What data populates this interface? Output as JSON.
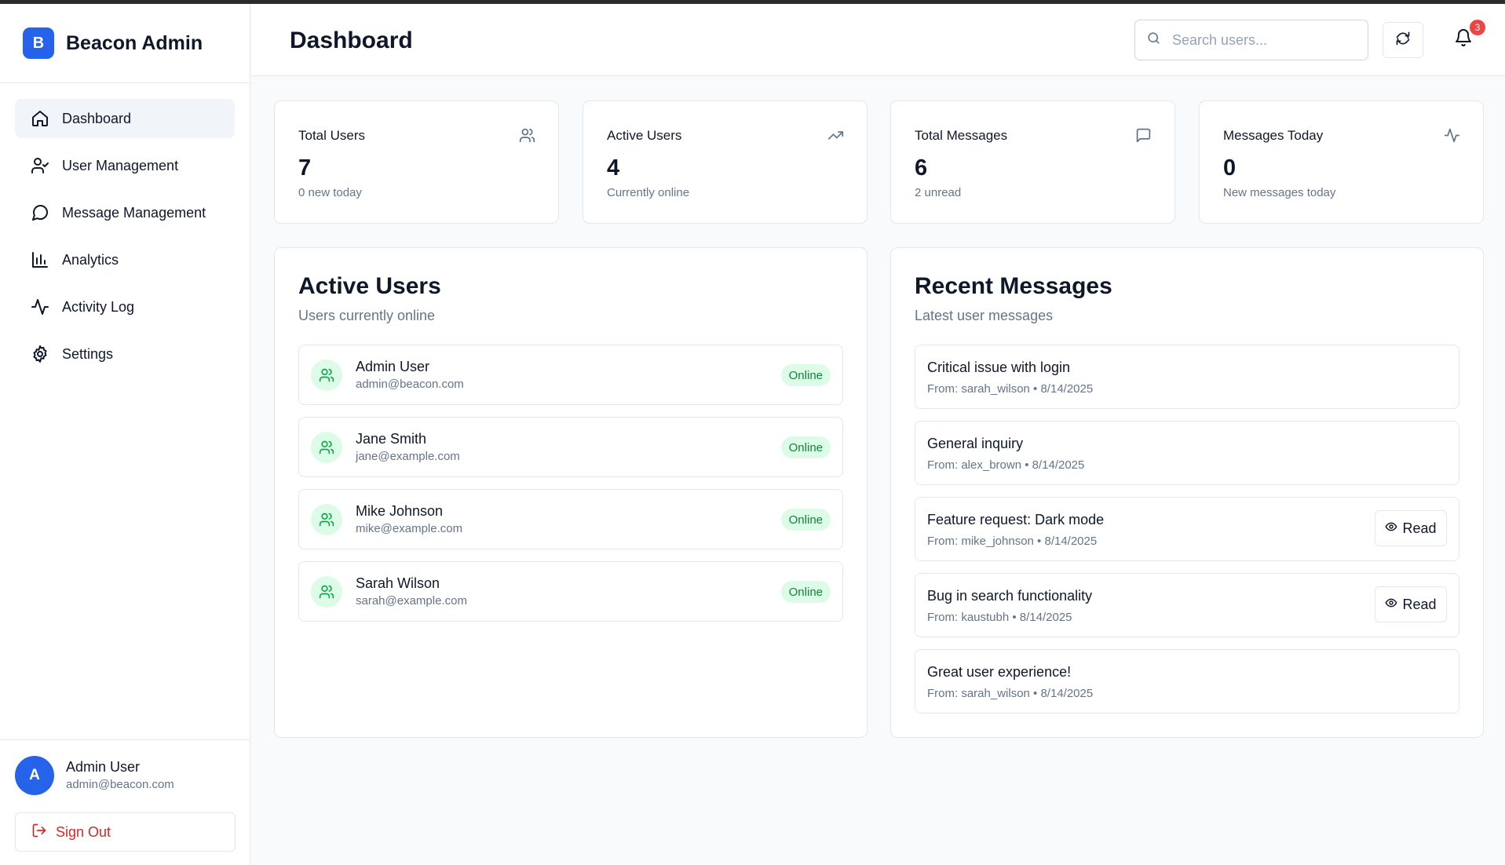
{
  "brand": {
    "logo_letter": "B",
    "name": "Beacon Admin",
    "accent": "#2563eb"
  },
  "nav": [
    {
      "label": "Dashboard",
      "icon": "home-icon",
      "active": true
    },
    {
      "label": "User Management",
      "icon": "user-check-icon"
    },
    {
      "label": "Message Management",
      "icon": "message-circle-icon"
    },
    {
      "label": "Analytics",
      "icon": "bar-chart-icon"
    },
    {
      "label": "Activity Log",
      "icon": "activity-icon"
    },
    {
      "label": "Settings",
      "icon": "gear-icon"
    }
  ],
  "footer": {
    "avatar_letter": "A",
    "user_name": "Admin User",
    "user_email": "admin@beacon.com",
    "signout_label": "Sign Out"
  },
  "header": {
    "title": "Dashboard",
    "search_placeholder": "Search users...",
    "notification_count": "3"
  },
  "stats": [
    {
      "title": "Total Users",
      "value": "7",
      "sub": "0 new today",
      "icon": "users-icon"
    },
    {
      "title": "Active Users",
      "value": "4",
      "sub": "Currently online",
      "icon": "trending-up-icon"
    },
    {
      "title": "Total Messages",
      "value": "6",
      "sub": "2 unread",
      "icon": "message-square-icon"
    },
    {
      "title": "Messages Today",
      "value": "0",
      "sub": "New messages today",
      "icon": "activity-icon"
    }
  ],
  "active_users": {
    "title": "Active Users",
    "subtitle": "Users currently online",
    "users": [
      {
        "name": "Admin User",
        "email": "admin@beacon.com",
        "status": "Online"
      },
      {
        "name": "Jane Smith",
        "email": "jane@example.com",
        "status": "Online"
      },
      {
        "name": "Mike Johnson",
        "email": "mike@example.com",
        "status": "Online"
      },
      {
        "name": "Sarah Wilson",
        "email": "sarah@example.com",
        "status": "Online"
      }
    ]
  },
  "recent_messages": {
    "title": "Recent Messages",
    "subtitle": "Latest user messages",
    "read_label": "Read",
    "messages": [
      {
        "subject": "Critical issue with login",
        "meta": "From: sarah_wilson • 8/14/2025",
        "unread": false
      },
      {
        "subject": "General inquiry",
        "meta": "From: alex_brown • 8/14/2025",
        "unread": false
      },
      {
        "subject": "Feature request: Dark mode",
        "meta": "From: mike_johnson • 8/14/2025",
        "unread": true
      },
      {
        "subject": "Bug in search functionality",
        "meta": "From: kaustubh • 8/14/2025",
        "unread": true
      },
      {
        "subject": "Great user experience!",
        "meta": "From: sarah_wilson • 8/14/2025",
        "unread": false
      }
    ]
  }
}
